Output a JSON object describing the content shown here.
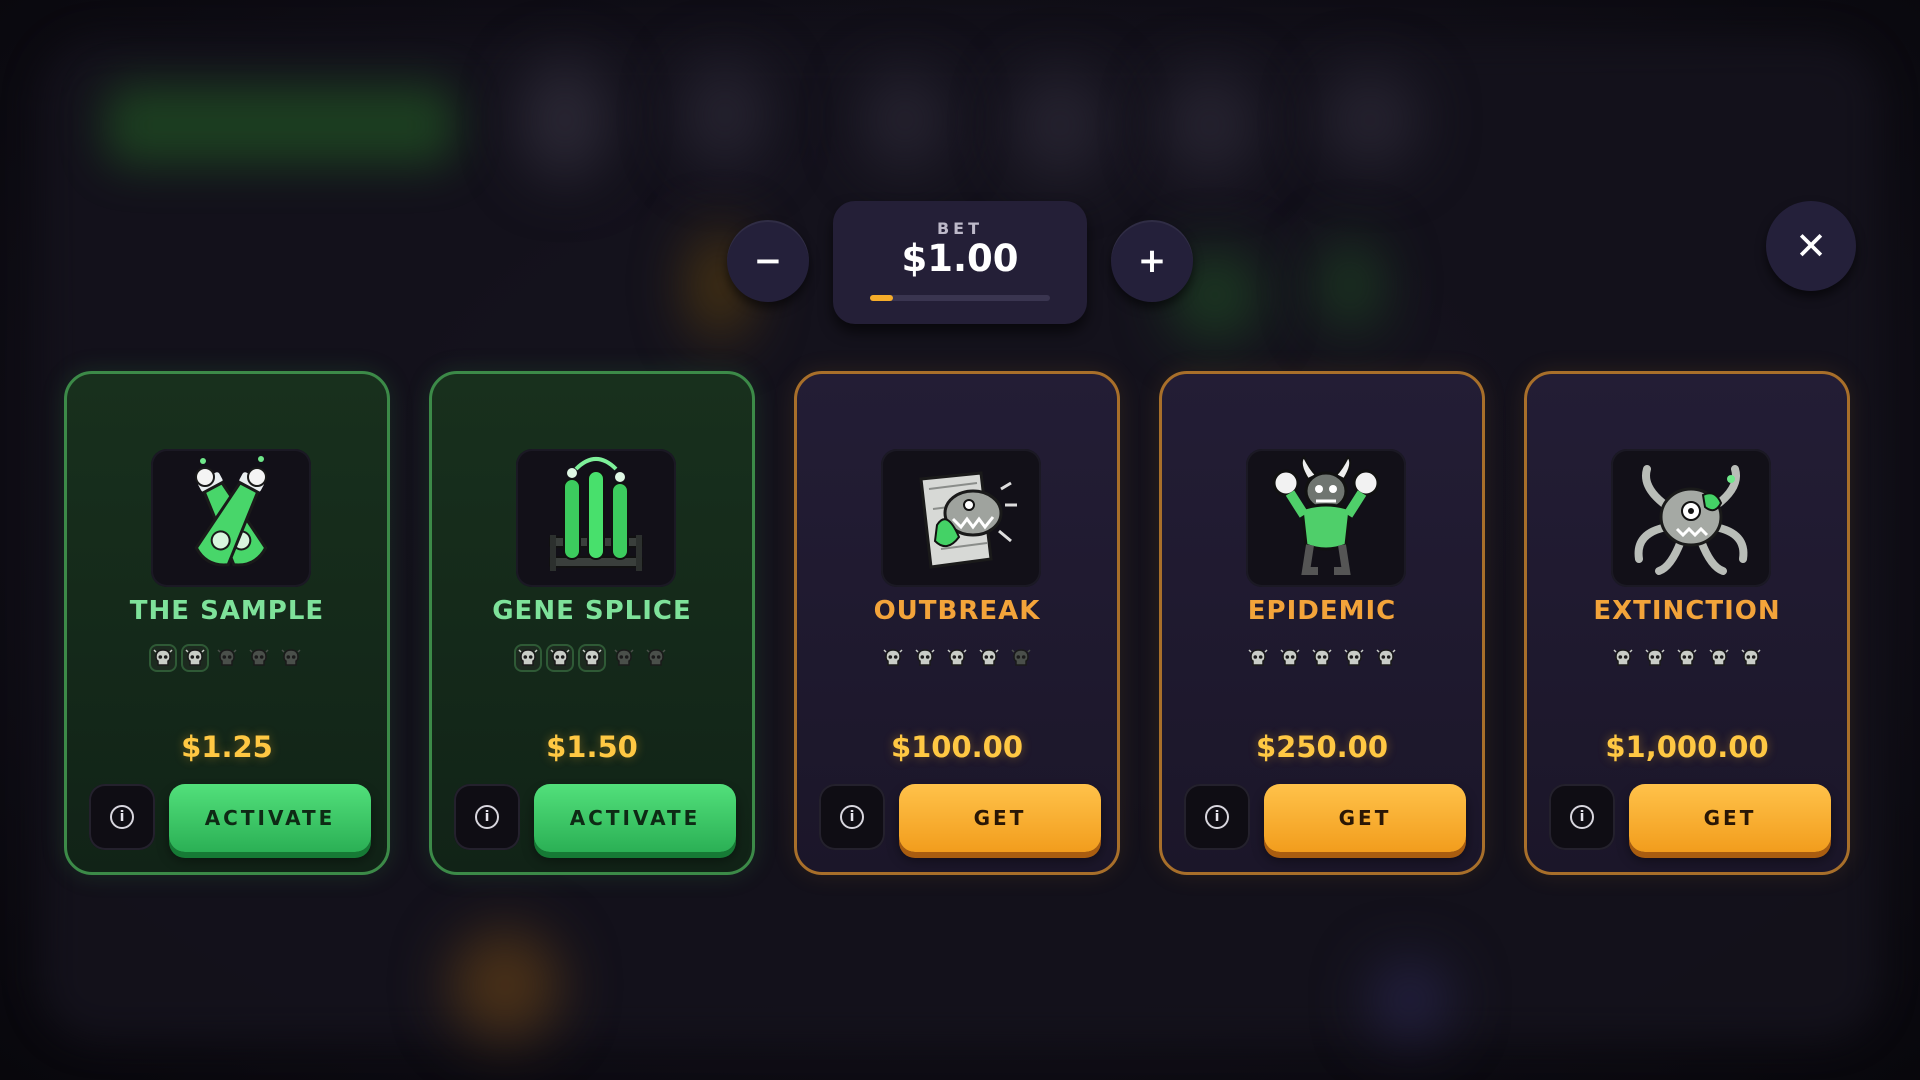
{
  "bet": {
    "label": "BET",
    "value": "$1.00",
    "minus_symbol": "−",
    "plus_symbol": "+",
    "level_fraction": 0.13
  },
  "close_symbol": "✕",
  "info_symbol": "i",
  "cards": [
    {
      "title": "THE SAMPLE",
      "price": "$1.25",
      "action": "ACTIVATE",
      "theme": "green",
      "skulls_active": 2,
      "skulls_total": 5,
      "icon": "crossed-test-tubes-icon"
    },
    {
      "title": "GENE SPLICE",
      "price": "$1.50",
      "action": "ACTIVATE",
      "theme": "green",
      "skulls_active": 3,
      "skulls_total": 5,
      "icon": "test-tube-rack-icon"
    },
    {
      "title": "OUTBREAK",
      "price": "$100.00",
      "action": "GET",
      "theme": "gold",
      "skulls_active": 4,
      "skulls_total": 5,
      "icon": "monster-crate-icon"
    },
    {
      "title": "EPIDEMIC",
      "price": "$250.00",
      "action": "GET",
      "theme": "gold",
      "skulls_active": 5,
      "skulls_total": 5,
      "icon": "horned-brute-icon"
    },
    {
      "title": "EXTINCTION",
      "price": "$1,000.00",
      "action": "GET",
      "theme": "gold",
      "skulls_active": 5,
      "skulls_total": 5,
      "icon": "tentacle-monster-icon"
    }
  ],
  "colors": {
    "green_accent": "#3c8a48",
    "gold_accent": "#a86f2a",
    "price": "#ffc843",
    "activate": "#2bb055",
    "get": "#f29d1d"
  }
}
